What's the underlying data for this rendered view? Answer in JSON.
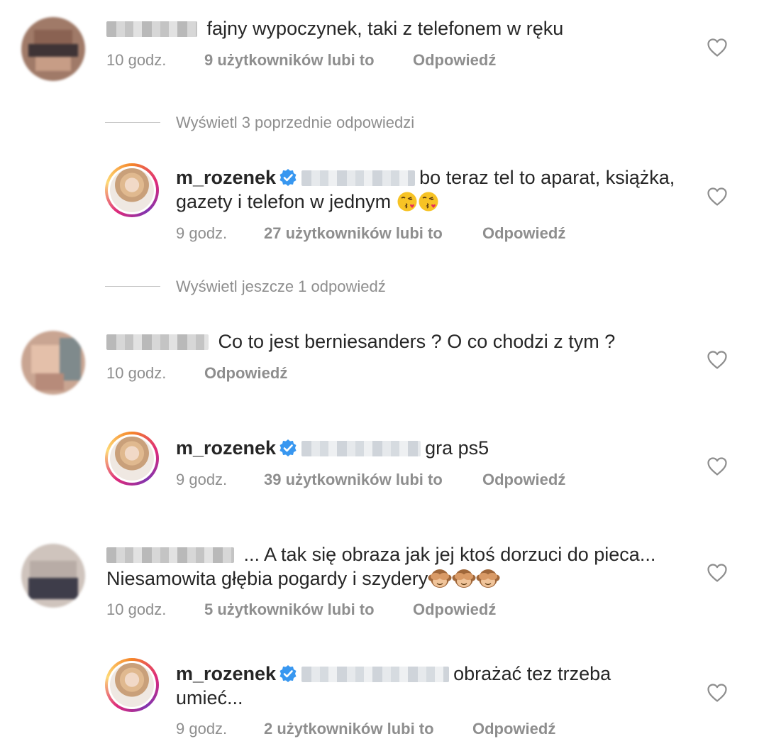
{
  "comments": [
    {
      "text": "fajny wypoczynek, taki z telefonem w ręku",
      "time": "10 godz.",
      "likes": "9 użytkowników lubi to",
      "reply": "Odpowiedź"
    },
    {
      "view_replies": "Wyświetl 3 poprzednie odpowiedzi"
    },
    {
      "username": "m_rozenek",
      "text_line1": "bo teraz tel to aparat, książka,",
      "text_line2": "gazety i telefon w jednym",
      "time": "9 godz.",
      "likes": "27 użytkowników lubi to",
      "reply": "Odpowiedź"
    },
    {
      "view_replies": "Wyświetl jeszcze 1 odpowiedź"
    },
    {
      "text": "Co to jest berniesanders ? O co chodzi z tym ?",
      "time": "10 godz.",
      "reply": "Odpowiedź"
    },
    {
      "username": "m_rozenek",
      "text": "gra ps5",
      "time": "9 godz.",
      "likes": "39 użytkowników lubi to",
      "reply": "Odpowiedź"
    },
    {
      "text_line1": "... A tak się obraza jak jej ktoś dorzuci do pieca...",
      "text_line2": "Niesamowita głębia pogardy i szydery",
      "time": "10 godz.",
      "likes": "5 użytkowników lubi to",
      "reply": "Odpowiedź"
    },
    {
      "username": "m_rozenek",
      "text_line1": "obrażać tez trzeba",
      "text_line2": "umieć...",
      "time": "9 godz.",
      "likes": "2 użytkowników lubi to",
      "reply": "Odpowiedź"
    }
  ],
  "icons": {
    "heart": "heart-outline-icon",
    "verified": "verified-badge-icon",
    "kiss_emoji": "face-blowing-kiss-emoji",
    "monkey_emoji": "see-no-evil-monkey-emoji"
  },
  "colors": {
    "text": "#262626",
    "secondary": "#8e8e8e",
    "verified": "#3897f0"
  }
}
